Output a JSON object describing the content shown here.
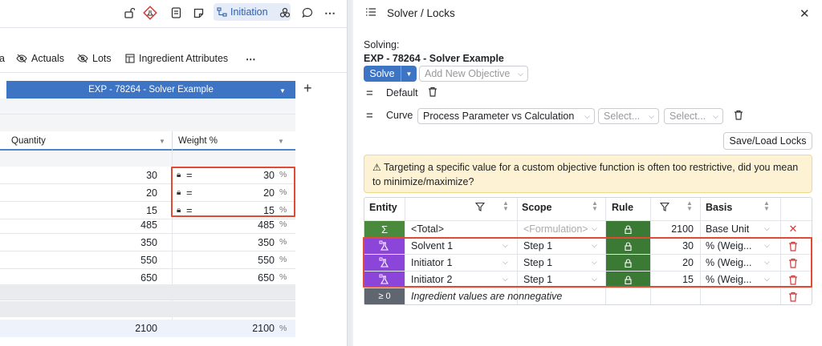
{
  "toolbar": {
    "initiation_label": "Initiation",
    "icons": [
      "unlock-icon",
      "flask-diamond-icon",
      "notes-icon",
      "sticky-note-icon",
      "workflow-icon",
      "cluster-icon",
      "comment-icon",
      "more-icon"
    ]
  },
  "subtabs": {
    "cut_prefix": "a",
    "actuals": "Actuals",
    "lots": "Lots",
    "ingredient_attributes": "Ingredient Attributes",
    "more": "⋯"
  },
  "left_table": {
    "experiment_label": "EXP - 78264 - Solver Example",
    "add_label": "+",
    "col_quantity": "Quantity",
    "col_weight": "Weight %",
    "pct_symbol": "%",
    "rows": [
      {
        "quantity": "30",
        "weight": "30",
        "locked": true
      },
      {
        "quantity": "20",
        "weight": "20",
        "locked": true
      },
      {
        "quantity": "15",
        "weight": "15",
        "locked": true
      },
      {
        "quantity": "485",
        "weight": "485",
        "locked": false
      },
      {
        "quantity": "350",
        "weight": "350",
        "locked": false
      },
      {
        "quantity": "550",
        "weight": "550",
        "locked": false
      },
      {
        "quantity": "650",
        "weight": "650",
        "locked": false
      }
    ],
    "total_quantity": "2100",
    "total_weight": "2100"
  },
  "panel": {
    "title": "Solver / Locks",
    "solving_label": "Solving:",
    "solving_target": "EXP - 78264 - Solver Example",
    "solve_button": "Solve",
    "add_objective_placeholder": "Add New Objective",
    "default_label": "Default",
    "curve_label": "Curve",
    "curve_value": "Process Parameter vs Calculation",
    "select_placeholder_1": "Select...",
    "select_placeholder_2": "Select...",
    "save_load_locks": "Save/Load Locks",
    "warning": "Targeting a specific value for a custom objective function is often too restrictive, did you mean to minimize/maximize?",
    "grid": {
      "col_entity": "Entity",
      "col_scope": "Scope",
      "col_rule": "Rule",
      "col_basis": "Basis",
      "total_row": {
        "entity": "<Total>",
        "scope": "<Formulation>",
        "value": "2100",
        "basis": "Base Unit"
      },
      "rows": [
        {
          "entity": "Solvent 1",
          "scope": "Step 1",
          "value": "30",
          "basis": "% (Weig..."
        },
        {
          "entity": "Initiator 1",
          "scope": "Step 1",
          "value": "20",
          "basis": "% (Weig..."
        },
        {
          "entity": "Initiator 2",
          "scope": "Step 1",
          "value": "15",
          "basis": "% (Weig..."
        }
      ],
      "constraint_row": {
        "badge": "≥ 0",
        "text": "Ingredient values are nonnegative"
      }
    }
  },
  "colors": {
    "accent": "#3d74c4",
    "rule_green": "#3a7a34",
    "ingredient_purple": "#8b45d8",
    "total_green": "#4a8a3c",
    "highlight_red": "#e04b35",
    "warning_bg": "#fdf3d4"
  }
}
